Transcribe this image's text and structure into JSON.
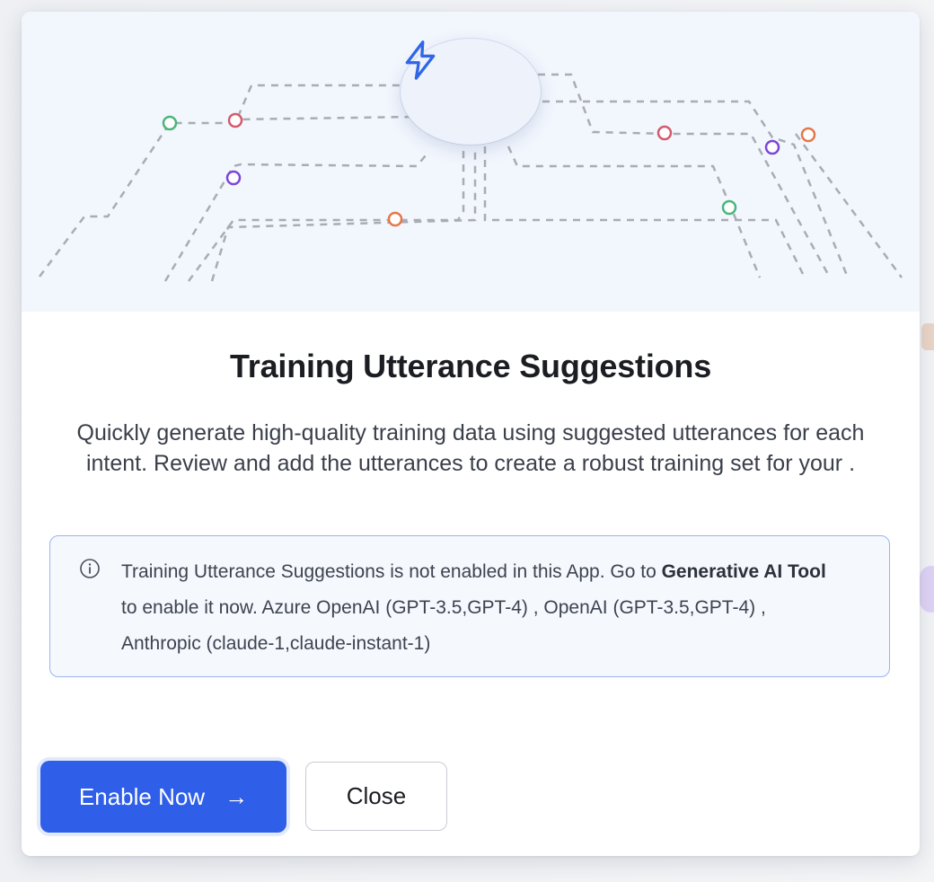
{
  "modal": {
    "title": "Training Utterance Suggestions",
    "description": "Quickly generate high-quality training data using suggested utterances for each intent. Review and add the utterances to create a robust training set for your .",
    "info": {
      "text_before": "Training Utterance Suggestions is not enabled in this App. Go to ",
      "link_text": "Generative AI Tool",
      "text_after": " to enable it now. Azure OpenAI (GPT-3.5,GPT-4) , OpenAI (GPT-3.5,GPT-4) , Anthropic (claude-1,claude-instant-1)"
    },
    "buttons": {
      "enable_label": "Enable Now",
      "enable_arrow": "→",
      "close_label": "Close"
    },
    "icons": {
      "hero": "lightning-bolt-icon",
      "info": "info-circle-icon",
      "arrow": "arrow-right-icon"
    },
    "colors": {
      "primary": "#2f5fe8",
      "info_border": "#9ab4f0",
      "node_green": "#4cb57a",
      "node_red": "#d45a6c",
      "node_purple": "#7a46d8",
      "node_orange": "#e4784a"
    }
  }
}
